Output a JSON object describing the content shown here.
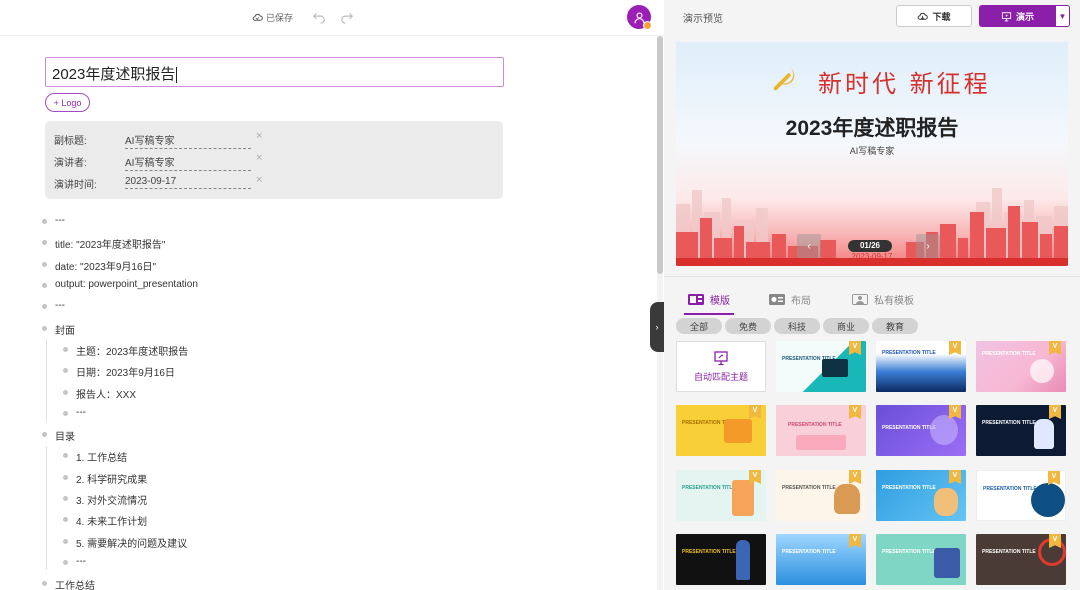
{
  "header": {
    "save_status": "已保存",
    "undo_icon": "undo-icon",
    "redo_icon": "redo-icon",
    "avatar_icon": "user-icon"
  },
  "editor": {
    "title": "2023年度述职报告",
    "logo_button": "+ Logo",
    "meta": [
      {
        "label": "副标题:",
        "value": "AI写稿专家"
      },
      {
        "label": "演讲者:",
        "value": "AI写稿专家"
      },
      {
        "label": "演讲时间:",
        "value": "2023-09-17"
      }
    ],
    "outline": [
      {
        "text": "---",
        "level": 0
      },
      {
        "text": "title: \"2023年度述职报告\"",
        "level": 0
      },
      {
        "text": "date: \"2023年9月16日\"",
        "level": 0
      },
      {
        "text": "output: powerpoint_presentation",
        "level": 0
      },
      {
        "text": "---",
        "level": 0
      },
      {
        "text": "封面",
        "level": 0
      },
      {
        "text": "主题：2023年度述职报告",
        "level": 1
      },
      {
        "text": "日期：2023年9月16日",
        "level": 1
      },
      {
        "text": "报告人：XXX",
        "level": 1
      },
      {
        "text": "---",
        "level": 1
      },
      {
        "text": "目录",
        "level": 0
      },
      {
        "text": "1. 工作总结",
        "level": 1
      },
      {
        "text": "2. 科学研究成果",
        "level": 1
      },
      {
        "text": "3. 对外交流情况",
        "level": 1
      },
      {
        "text": "4. 未来工作计划",
        "level": 1
      },
      {
        "text": "5. 需要解决的问题及建议",
        "level": 1
      },
      {
        "text": "---",
        "level": 1
      },
      {
        "text": "工作总结",
        "level": 0
      }
    ]
  },
  "preview": {
    "label": "演示预览",
    "download_button": "下载",
    "present_button": "演示",
    "slide": {
      "slogan": "新时代 新征程",
      "title": "2023年度述职报告",
      "subtitle": "AI写稿专家",
      "date": "2023-09-17",
      "page_indicator": "01/26"
    }
  },
  "templates": {
    "tabs": [
      {
        "label": "模版",
        "active": true
      },
      {
        "label": "布局",
        "active": false
      },
      {
        "label": "私有模板",
        "active": false
      }
    ],
    "chips": [
      "全部",
      "免费",
      "科技",
      "商业",
      "教育"
    ],
    "auto_match_label": "自动匹配主题",
    "thumb_title": "PRESENTATION TITLE",
    "vip_badge": "V",
    "accent": "#8b1fa9"
  }
}
